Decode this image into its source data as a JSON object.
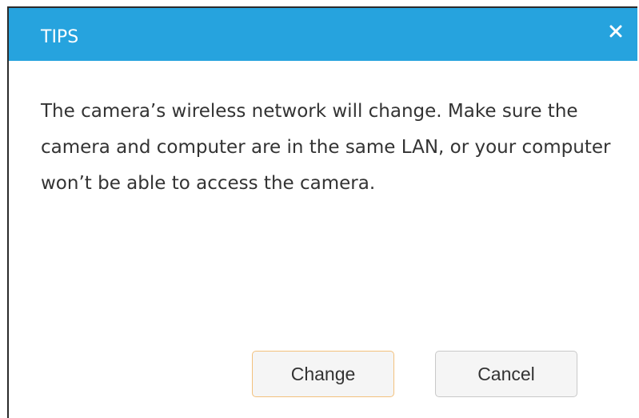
{
  "dialog": {
    "title": "TIPS",
    "close_icon": "close-icon",
    "message": "The camera’s wireless network will change. Make sure the camera and computer are in the same LAN, or your computer won’t be able to access the camera.",
    "buttons": {
      "change_label": "Change",
      "cancel_label": "Cancel"
    }
  },
  "colors": {
    "header": "#26a3de",
    "title_text": "#ffffff",
    "body_text": "#333333",
    "primary_button_border": "#f3c17d",
    "button_border": "#c9c9c9"
  }
}
